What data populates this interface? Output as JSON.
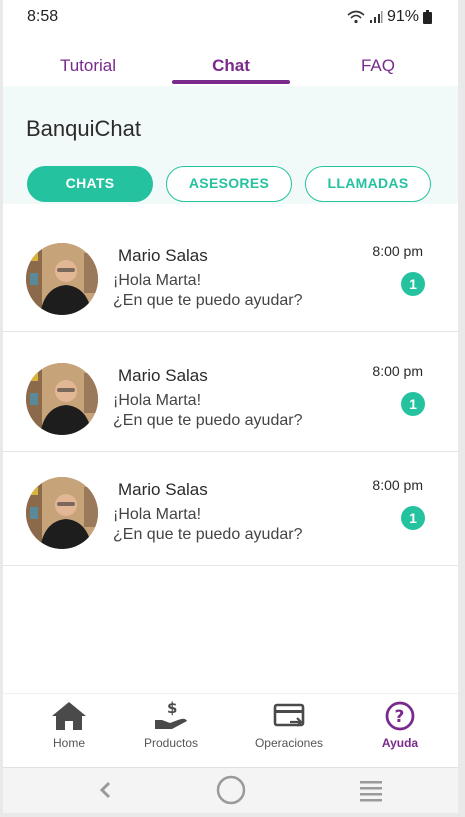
{
  "status_bar": {
    "time": "8:58",
    "battery": "91%"
  },
  "tabs": [
    {
      "label": "Tutorial",
      "active": false
    },
    {
      "label": "Chat",
      "active": true
    },
    {
      "label": "FAQ",
      "active": false
    }
  ],
  "header": {
    "title": "BanquiChat"
  },
  "filters": [
    {
      "label": "CHATS",
      "active": true
    },
    {
      "label": "ASESORES",
      "active": false
    },
    {
      "label": "LLAMADAS",
      "active": false
    }
  ],
  "chats": [
    {
      "name": "Mario Salas",
      "message_line1": "¡Hola Marta!",
      "message_line2": "¿En que te puedo ayudar?",
      "time": "8:00 pm",
      "unread": "1"
    },
    {
      "name": "Mario Salas",
      "message_line1": "¡Hola Marta!",
      "message_line2": "¿En que te puedo ayudar?",
      "time": "8:00 pm",
      "unread": "1"
    },
    {
      "name": "Mario Salas",
      "message_line1": "¡Hola Marta!",
      "message_line2": "¿En que te puedo ayudar?",
      "time": "8:00 pm",
      "unread": "1"
    }
  ],
  "bottom_nav": [
    {
      "label": "Home",
      "icon": "home-icon",
      "active": false
    },
    {
      "label": "Productos",
      "icon": "hand-money-icon",
      "active": false
    },
    {
      "label": "Operaciones",
      "icon": "card-transfer-icon",
      "active": false
    },
    {
      "label": "Ayuda",
      "icon": "help-circle-icon",
      "active": true
    }
  ],
  "colors": {
    "primary_purple": "#7a2a8c",
    "accent_teal": "#25c2a0",
    "header_bg": "#f1faf8"
  }
}
